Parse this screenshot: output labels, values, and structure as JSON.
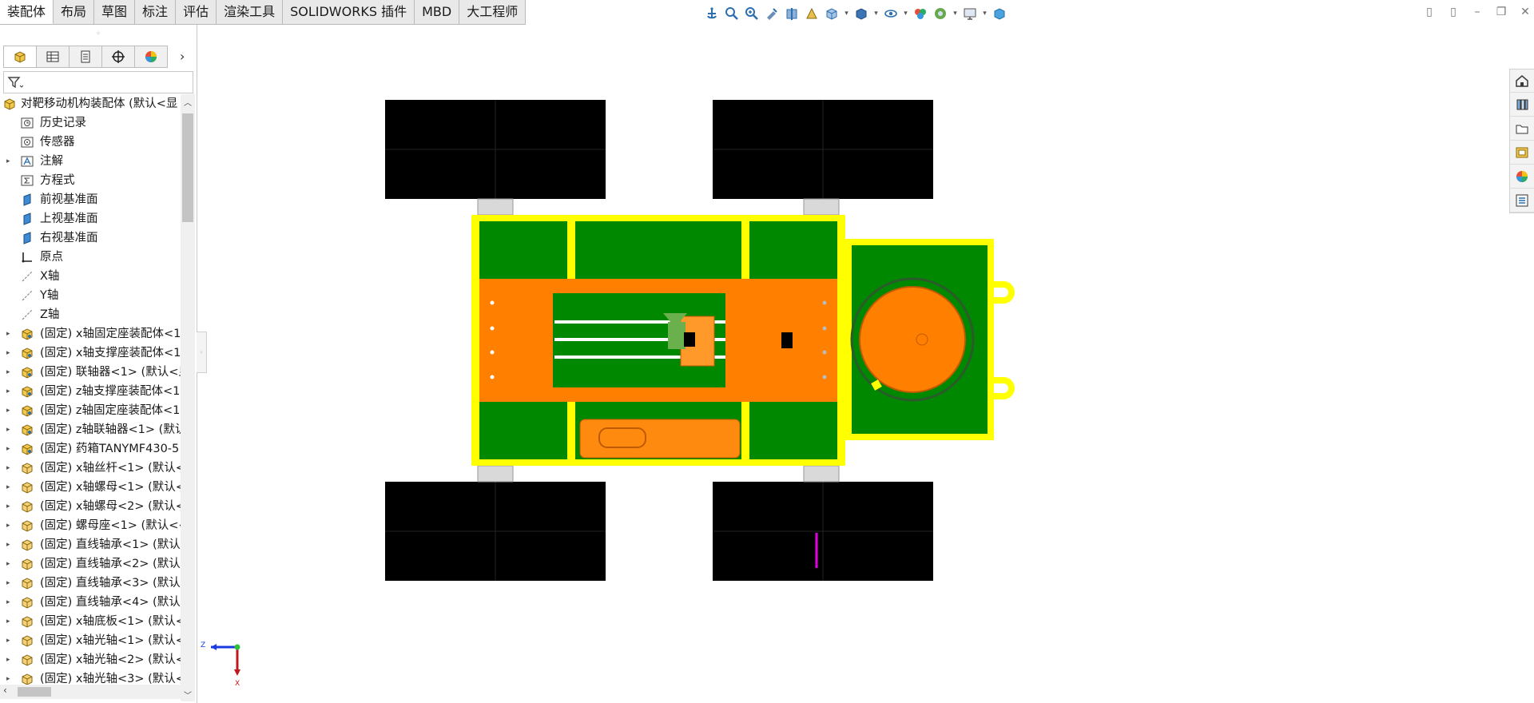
{
  "tabs": [
    "装配体",
    "布局",
    "草图",
    "标注",
    "评估",
    "渲染工具",
    "SOLIDWORKS 插件",
    "MBD",
    "大工程师"
  ],
  "active_tab": 0,
  "hud_icons": [
    "anchor-icon",
    "zoom-fit-icon",
    "zoom-area-icon",
    "previous-view-icon",
    "section-view-icon",
    "dynamic-annotation-icon",
    "view-orientation-icon",
    "display-style-icon",
    "hide-show-icon",
    "edit-appearance-icon",
    "apply-scene-icon",
    "view-settings-icon",
    "realview-icon"
  ],
  "feature_tree": {
    "root": "对靶移动机构装配体 (默认<显",
    "items": [
      {
        "label": "历史记录",
        "icon": "history-icon",
        "expand": false
      },
      {
        "label": "传感器",
        "icon": "sensor-icon",
        "expand": false
      },
      {
        "label": "注解",
        "icon": "annotation-icon",
        "expand": true
      },
      {
        "label": "方程式",
        "icon": "equation-icon",
        "expand": false
      },
      {
        "label": "前视基准面",
        "icon": "plane-icon",
        "expand": false
      },
      {
        "label": "上视基准面",
        "icon": "plane-icon",
        "expand": false
      },
      {
        "label": "右视基准面",
        "icon": "plane-icon",
        "expand": false
      },
      {
        "label": "原点",
        "icon": "origin-icon",
        "expand": false
      },
      {
        "label": "X轴",
        "icon": "axis-icon",
        "expand": false
      },
      {
        "label": "Y轴",
        "icon": "axis-icon",
        "expand": false
      },
      {
        "label": "Z轴",
        "icon": "axis-icon",
        "expand": false
      },
      {
        "label": "(固定) x轴固定座装配体<1",
        "icon": "subassembly-icon",
        "expand": true
      },
      {
        "label": "(固定) x轴支撑座装配体<1",
        "icon": "subassembly-icon",
        "expand": true
      },
      {
        "label": "(固定) 联轴器<1> (默认<显",
        "icon": "subassembly-icon",
        "expand": true
      },
      {
        "label": "(固定) z轴支撑座装配体<1",
        "icon": "subassembly-icon",
        "expand": true
      },
      {
        "label": "(固定) z轴固定座装配体<1",
        "icon": "subassembly-icon",
        "expand": true
      },
      {
        "label": "(固定) z轴联轴器<1> (默认",
        "icon": "subassembly-icon",
        "expand": true
      },
      {
        "label": "(固定) 药箱TANYMF430-5",
        "icon": "subassembly-icon",
        "expand": true
      },
      {
        "label": "(固定) x轴丝杆<1> (默认<",
        "icon": "part-icon",
        "expand": true
      },
      {
        "label": "(固定) x轴螺母<1> (默认<",
        "icon": "part-icon",
        "expand": true
      },
      {
        "label": "(固定) x轴螺母<2> (默认<",
        "icon": "part-icon",
        "expand": true
      },
      {
        "label": "(固定) 螺母座<1> (默认<<",
        "icon": "part-icon",
        "expand": true
      },
      {
        "label": "(固定) 直线轴承<1> (默认",
        "icon": "part-icon",
        "expand": true
      },
      {
        "label": "(固定) 直线轴承<2> (默认",
        "icon": "part-icon",
        "expand": true
      },
      {
        "label": "(固定) 直线轴承<3> (默认",
        "icon": "part-icon",
        "expand": true
      },
      {
        "label": "(固定) 直线轴承<4> (默认",
        "icon": "part-icon",
        "expand": true
      },
      {
        "label": "(固定) x轴底板<1> (默认<",
        "icon": "part-icon",
        "expand": true
      },
      {
        "label": "(固定) x轴光轴<1> (默认<",
        "icon": "part-icon",
        "expand": true
      },
      {
        "label": "(固定) x轴光轴<2> (默认<",
        "icon": "part-icon",
        "expand": true
      },
      {
        "label": "(固定) x轴光轴<3> (默认<",
        "icon": "part-icon",
        "expand": true
      }
    ]
  },
  "taskpane_icons": [
    "home-icon",
    "design-library-icon",
    "file-explorer-icon",
    "view-palette-icon",
    "appearances-icon",
    "custom-properties-icon"
  ],
  "triad": {
    "z_label": "Z",
    "x_label": "X"
  },
  "colors": {
    "chassis_yellow": "#ffff00",
    "plate_green": "#008800",
    "slide_orange": "#ff7f00",
    "wheel_black": "#000000"
  }
}
